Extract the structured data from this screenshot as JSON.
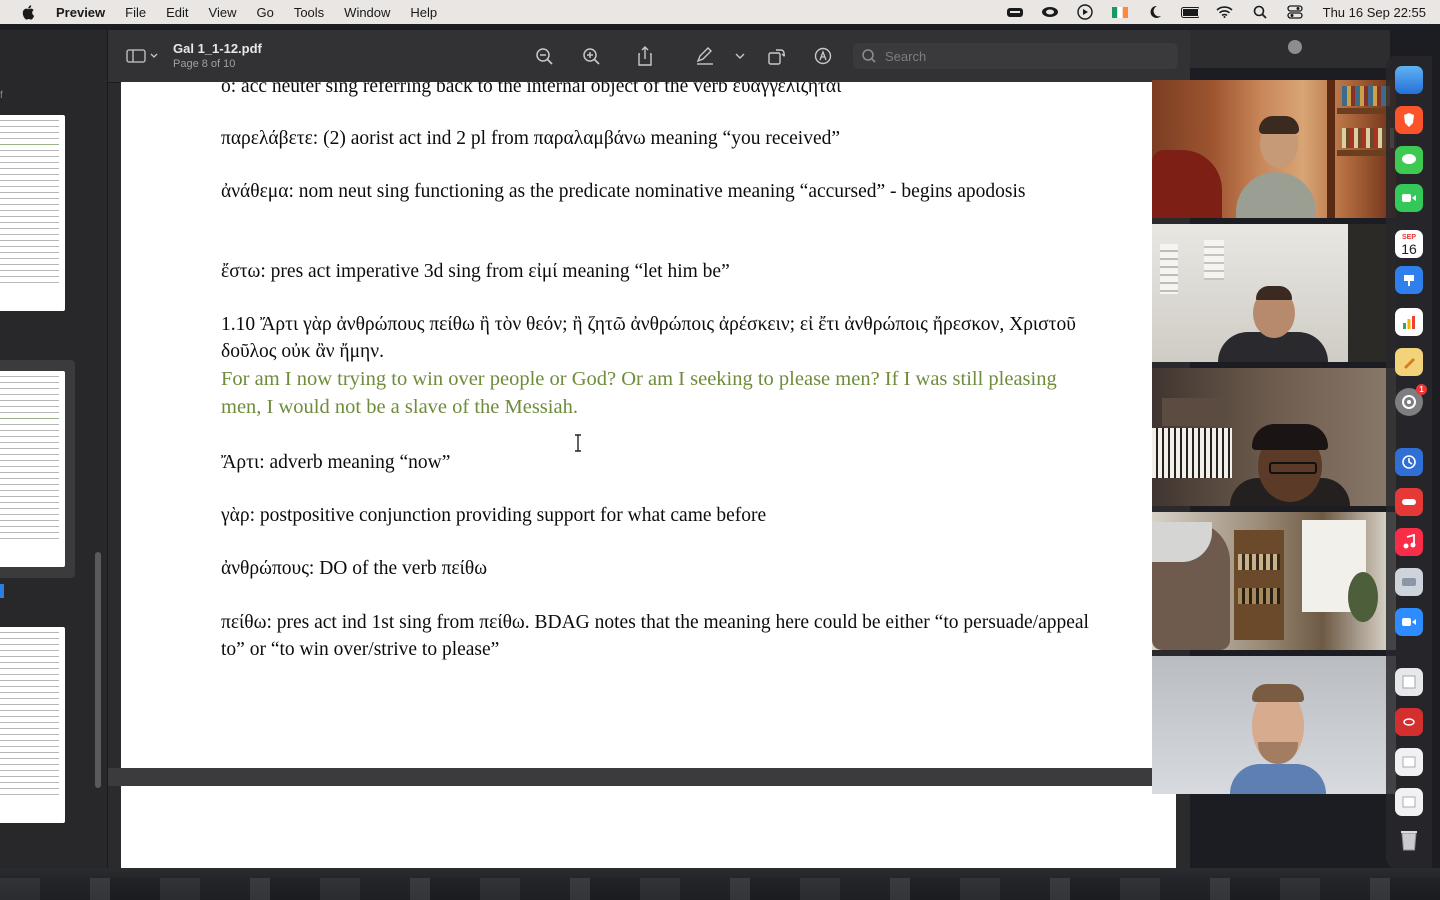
{
  "menubar": {
    "app_name": "Preview",
    "items": [
      "File",
      "Edit",
      "View",
      "Go",
      "Tools",
      "Window",
      "Help"
    ],
    "clock": "Thu 16 Sep  22:55"
  },
  "toolbar": {
    "doc_title": "Gal 1_1-12.pdf",
    "page_indicator": "Page 8 of 10",
    "search_placeholder": "Search"
  },
  "sidebar": {
    "label": "f"
  },
  "document": {
    "paragraphs": [
      "ὅ: acc neuter sing referring back to the internal object of the verb εὐαγγελίζηται",
      "παρελάβετε: (2) aorist act ind 2 pl from παραλαμβάνω meaning “you received”",
      "ἀνάθεμα: nom neut sing functioning as the predicate nominative meaning “accursed” - begins apodosis",
      "ἔστω: pres act imperative 3d sing from εἰμί meaning “let him be”",
      "1.10 Ἄρτι γὰρ ἀνθρώπους πείθω ἢ τὸν θεόν; ἢ ζητῶ ἀνθρώποις ἀρέσκειν; εἰ ἔτι ἀνθρώποις ἤρεσκον, Χριστοῦ δοῦλος οὐκ ἂν ἤμην.",
      "Ἄρτι: adverb meaning “now”",
      "γὰρ: postpositive conjunction providing support for what came before",
      "ἀνθρώπους: DO of the verb πείθω",
      "πείθω: pres act ind 1st sing from πείθω.  BDAG notes that the meaning here could be either “to persuade/appeal to” or “to win over/strive to please”"
    ],
    "translation": "For am I now trying to win over people or God?  Or am I seeking to please men?  If I was still pleasing men, I would not be a slave of the Messiah."
  },
  "dock": {
    "calendar_month": "SEP",
    "calendar_day": "16",
    "settings_badge": "1"
  },
  "colors": {
    "translation_green": "#6e8c3a",
    "accent_blue": "#2a7de1"
  }
}
